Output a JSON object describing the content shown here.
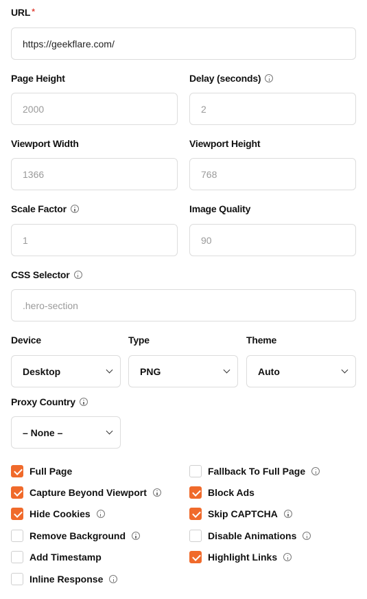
{
  "url": {
    "label": "URL",
    "required_mark": "*",
    "value": "https://geekflare.com/"
  },
  "page_height": {
    "label": "Page Height",
    "placeholder": "2000"
  },
  "delay": {
    "label": "Delay (seconds)",
    "placeholder": "2"
  },
  "viewport_width": {
    "label": "Viewport Width",
    "placeholder": "1366"
  },
  "viewport_height": {
    "label": "Viewport Height",
    "placeholder": "768"
  },
  "scale_factor": {
    "label": "Scale Factor",
    "placeholder": "1"
  },
  "image_quality": {
    "label": "Image Quality",
    "placeholder": "90"
  },
  "css_selector": {
    "label": "CSS Selector",
    "placeholder": ".hero-section"
  },
  "device": {
    "label": "Device",
    "value": "Desktop"
  },
  "type": {
    "label": "Type",
    "value": "PNG"
  },
  "theme": {
    "label": "Theme",
    "value": "Auto"
  },
  "proxy_country": {
    "label": "Proxy Country",
    "value": "– None –"
  },
  "options": [
    {
      "label": "Full Page",
      "checked": true
    },
    {
      "label": "Fallback To Full Page",
      "checked": false
    },
    {
      "label": "Capture Beyond Viewport",
      "checked": true
    },
    {
      "label": "Block Ads",
      "checked": true
    },
    {
      "label": "Hide Cookies",
      "checked": true
    },
    {
      "label": "Skip CAPTCHA",
      "checked": true
    },
    {
      "label": "Remove Background",
      "checked": false
    },
    {
      "label": "Disable Animations",
      "checked": false
    },
    {
      "label": "Add Timestamp",
      "checked": false
    },
    {
      "label": "Highlight Links",
      "checked": true
    },
    {
      "label": "Inline Response",
      "checked": false
    }
  ],
  "colors": {
    "accent": "#f06a2b",
    "required": "#e0443a",
    "border": "#dcdcdc",
    "placeholder": "#9a9a9a"
  }
}
